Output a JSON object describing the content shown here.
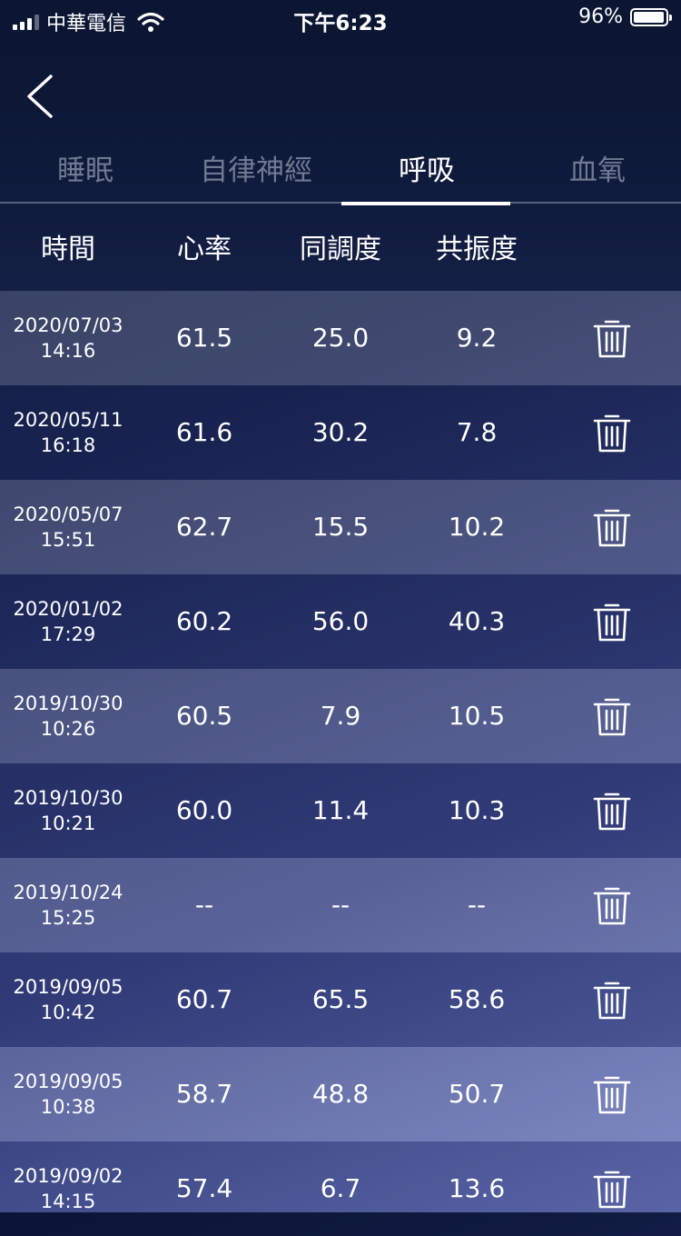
{
  "status_bar": {
    "carrier": "中華電信",
    "time": "下午6:23",
    "battery_percent": "96%"
  },
  "tabs": [
    {
      "label": "睡眠",
      "active": false
    },
    {
      "label": "自律神經",
      "active": false
    },
    {
      "label": "呼吸",
      "active": true
    },
    {
      "label": "血氧",
      "active": false
    }
  ],
  "columns": {
    "time": "時間",
    "heart_rate": "心率",
    "coherence": "同調度",
    "resonance": "共振度"
  },
  "rows": [
    {
      "date": "2020/07/03",
      "time": "14:16",
      "heart_rate": "61.5",
      "coherence": "25.0",
      "resonance": "9.2"
    },
    {
      "date": "2020/05/11",
      "time": "16:18",
      "heart_rate": "61.6",
      "coherence": "30.2",
      "resonance": "7.8"
    },
    {
      "date": "2020/05/07",
      "time": "15:51",
      "heart_rate": "62.7",
      "coherence": "15.5",
      "resonance": "10.2"
    },
    {
      "date": "2020/01/02",
      "time": "17:29",
      "heart_rate": "60.2",
      "coherence": "56.0",
      "resonance": "40.3"
    },
    {
      "date": "2019/10/30",
      "time": "10:26",
      "heart_rate": "60.5",
      "coherence": "7.9",
      "resonance": "10.5"
    },
    {
      "date": "2019/10/30",
      "time": "10:21",
      "heart_rate": "60.0",
      "coherence": "11.4",
      "resonance": "10.3"
    },
    {
      "date": "2019/10/24",
      "time": "15:25",
      "heart_rate": "--",
      "coherence": "--",
      "resonance": "--"
    },
    {
      "date": "2019/09/05",
      "time": "10:42",
      "heart_rate": "60.7",
      "coherence": "65.5",
      "resonance": "58.6"
    },
    {
      "date": "2019/09/05",
      "time": "10:38",
      "heart_rate": "58.7",
      "coherence": "48.8",
      "resonance": "50.7"
    },
    {
      "date": "2019/09/02",
      "time": "14:15",
      "heart_rate": "57.4",
      "coherence": "6.7",
      "resonance": "13.6"
    }
  ],
  "icons": {
    "back": "chevron-left-icon",
    "delete": "trash-icon",
    "wifi": "wifi-icon",
    "battery": "battery-icon",
    "signal": "cellular-signal-icon"
  }
}
